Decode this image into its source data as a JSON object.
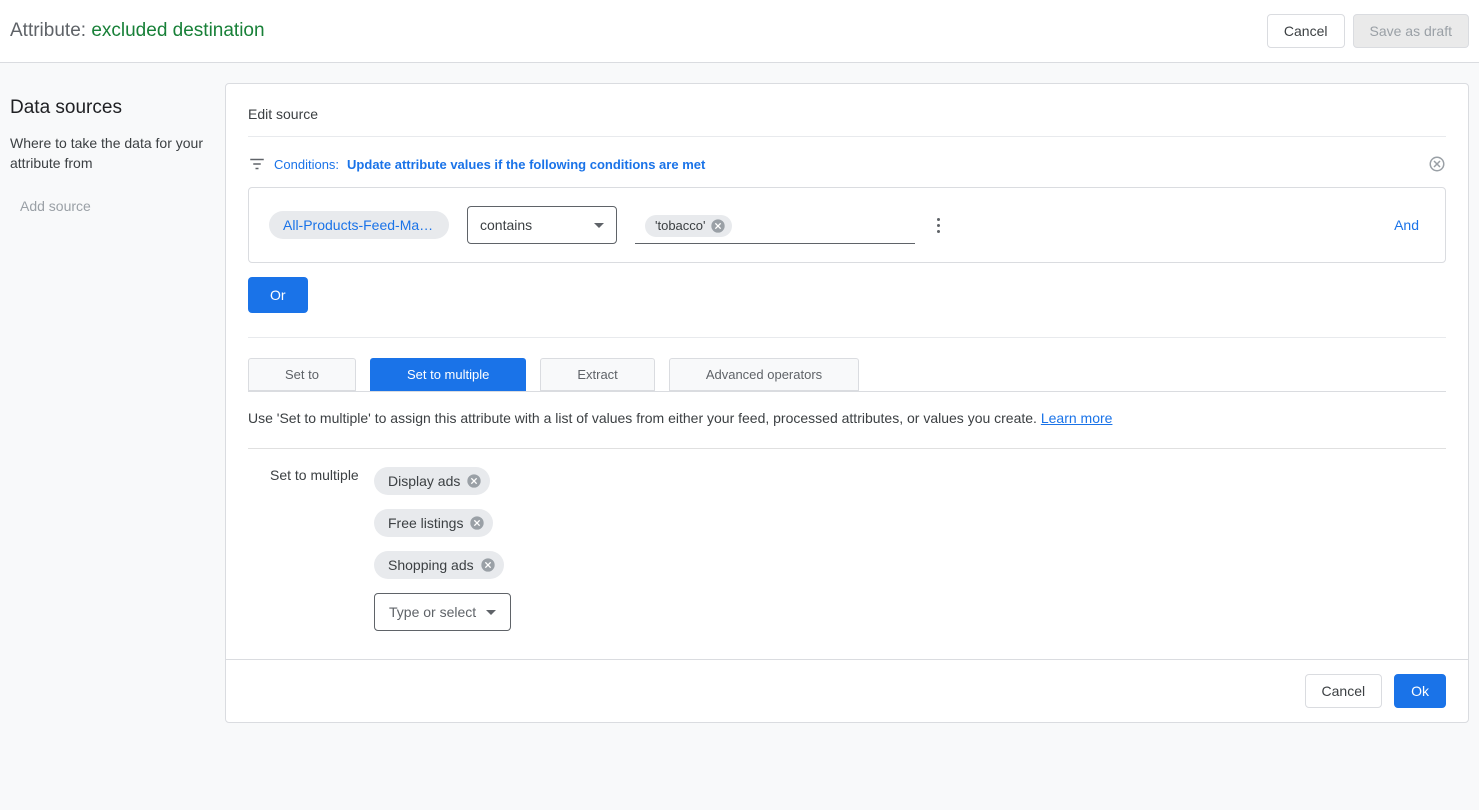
{
  "header": {
    "attr_label": "Attribute: ",
    "attr_value": "excluded destination",
    "cancel": "Cancel",
    "save_draft": "Save as draft"
  },
  "sidebar": {
    "title": "Data sources",
    "desc": "Where to take the data for your attribute from",
    "add_source": "Add source"
  },
  "panel": {
    "edit_source": "Edit source",
    "conditions_label": "Conditions:",
    "conditions_text": "Update attribute values if the following conditions are met",
    "condition": {
      "chip": "All-Products-Feed-Magent…",
      "operator": "contains",
      "value": "'tobacco'"
    },
    "and": "And",
    "or": "Or",
    "tabs": [
      "Set to",
      "Set to multiple",
      "Extract",
      "Advanced operators"
    ],
    "helper": "Use 'Set to multiple' to assign this attribute with a list of values from either your feed, processed attributes, or values you create. ",
    "learn_more": "Learn more",
    "multi_label": "Set to multiple",
    "multi_values": [
      "Display ads",
      "Free listings",
      "Shopping ads"
    ],
    "type_select": "Type or select",
    "footer_cancel": "Cancel",
    "footer_ok": "Ok"
  }
}
